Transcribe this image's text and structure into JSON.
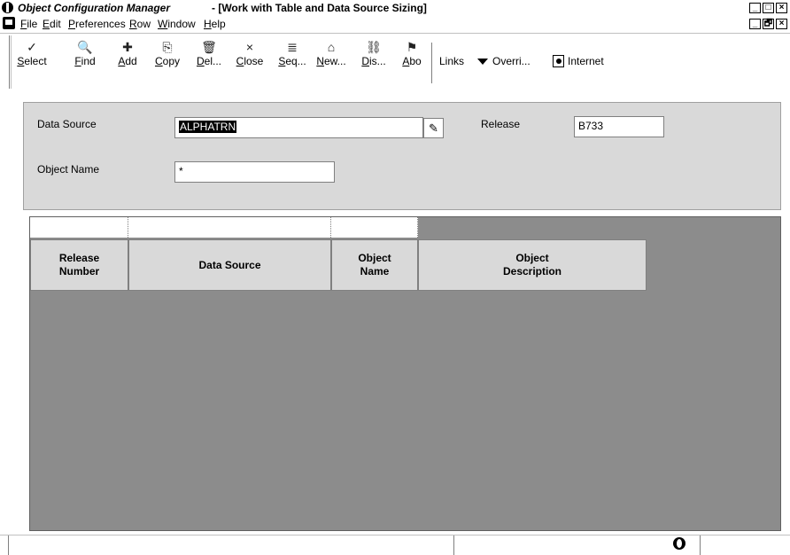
{
  "window": {
    "app_title": "Object Configuration Manager",
    "doc_title": "- [Work with Table and Data Source Sizing]",
    "minimize_glyph": "_",
    "restore_glyph": "□",
    "close_glyph": "×",
    "child_restore_glyph": "🗗"
  },
  "menu": {
    "items": [
      "File",
      "Edit",
      "Preferences",
      "Row",
      "Window",
      "Help"
    ]
  },
  "toolbar": {
    "buttons": [
      {
        "label": "Select",
        "icon": "check-icon",
        "glyph": "✓"
      },
      {
        "label": "Find",
        "icon": "find-icon",
        "glyph": "🔍"
      },
      {
        "label": "Add",
        "icon": "add-icon",
        "glyph": "✚"
      },
      {
        "label": "Copy",
        "icon": "copy-icon",
        "glyph": "⎘"
      },
      {
        "label": "Del...",
        "icon": "trash-icon",
        "glyph": "🗑"
      },
      {
        "label": "Close",
        "icon": "close-icon",
        "glyph": "×"
      },
      {
        "label": "Seq...",
        "icon": "sequence-icon",
        "glyph": "≣"
      },
      {
        "label": "New...",
        "icon": "new-icon",
        "glyph": "⌂"
      },
      {
        "label": "Dis...",
        "icon": "display-icon",
        "glyph": "⛓"
      },
      {
        "label": "Abo",
        "icon": "about-icon",
        "glyph": "⚑"
      }
    ],
    "links_label": "Links",
    "overrides_label": "Overri...",
    "internet_label": "Internet"
  },
  "form": {
    "data_source_label": "Data Source",
    "data_source_value": "ALPHATRN",
    "release_label": "Release",
    "release_value": "B733",
    "object_name_label": "Object Name",
    "object_name_value": "*"
  },
  "grid": {
    "columns": [
      "Release\nNumber",
      "Data Source",
      "Object\nName",
      "Object\nDescription"
    ],
    "rows": []
  },
  "colors": {
    "grid_background": "#8c8c8c",
    "header_background": "#d9d9d9",
    "selection": "#000000"
  }
}
